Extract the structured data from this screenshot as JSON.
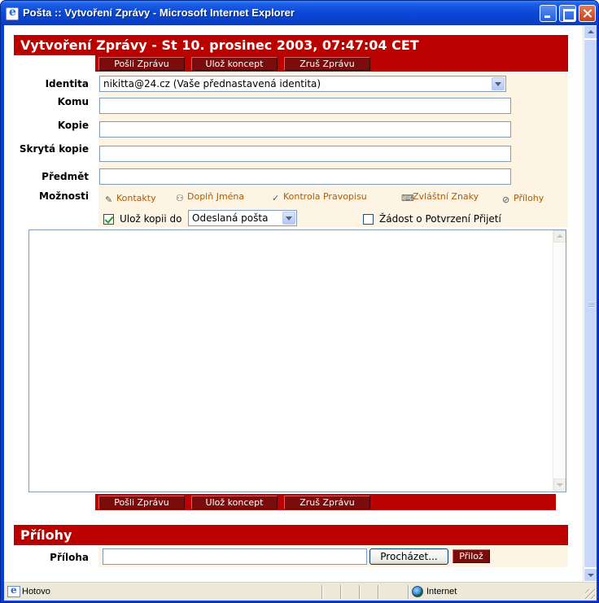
{
  "window": {
    "title": "Pošta :: Vytvoření Zprávy - Microsoft Internet Explorer"
  },
  "compose": {
    "header": "Vytvoření Zprávy - St 10. prosinec 2003, 07:47:04 CET",
    "buttons": {
      "send": "Pošli Zprávu",
      "save_draft": "Ulož koncept",
      "cancel": "Zruš Zprávu"
    },
    "labels": {
      "identity": "Identita",
      "to": "Komu",
      "cc": "Kopie",
      "bcc": "Skrytá kopie",
      "subject": "Předmět",
      "options": "Možnosti"
    },
    "identity_value": "nikitta@24.cz (Vaše přednastavená identita)",
    "to_value": "",
    "cc_value": "",
    "bcc_value": "",
    "subject_value": "",
    "tools": {
      "contacts": "Kontakty",
      "expand_names": "Doplň Jména",
      "spellcheck": "Kontrola Pravopisu",
      "special_chars": "Zvláštní Znaky",
      "attachments": "Přílohy"
    },
    "save_copy": {
      "checked": true,
      "label": "Ulož kopii do",
      "folder": "Odeslaná pošta"
    },
    "read_receipt": {
      "checked": false,
      "label": "Žádost o Potvrzení Přijetí"
    },
    "body": ""
  },
  "attachments": {
    "header": "Přílohy",
    "label": "Příloha",
    "file_value": "",
    "browse_button": "Procházet...",
    "attach_button": "Přilož"
  },
  "statusbar": {
    "status": "Hotovo",
    "zone": "Internet"
  }
}
